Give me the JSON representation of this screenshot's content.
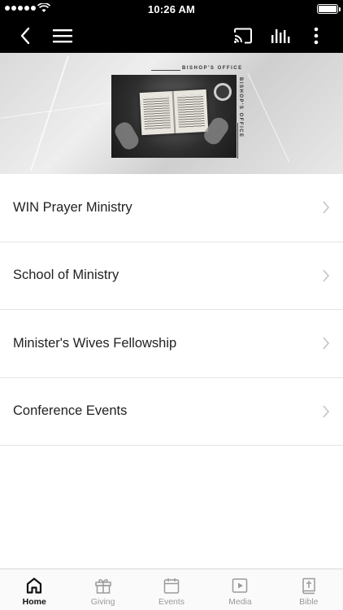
{
  "status_bar": {
    "time": "10:26 AM"
  },
  "nav": {
    "icons": [
      "back-icon",
      "menu-icon",
      "cast-icon",
      "equalizer-icon",
      "more-vertical-icon"
    ]
  },
  "banner": {
    "label": "BISHOP'S OFFICE",
    "colors": {
      "background": "#e2e2e2",
      "photo": "#2e2e2e"
    }
  },
  "list": {
    "items": [
      {
        "label": "WIN Prayer Ministry"
      },
      {
        "label": "School of Ministry"
      },
      {
        "label": "Minister's Wives Fellowship"
      },
      {
        "label": "Conference Events"
      }
    ]
  },
  "tab_bar": {
    "active": "Home",
    "tabs": [
      {
        "label": "Home",
        "icon": "home-icon"
      },
      {
        "label": "Giving",
        "icon": "gift-icon"
      },
      {
        "label": "Events",
        "icon": "calendar-icon"
      },
      {
        "label": "Media",
        "icon": "play-icon"
      },
      {
        "label": "Bible",
        "icon": "bible-icon"
      }
    ]
  },
  "colors": {
    "bars": "#000000",
    "active_tab": "#111111",
    "inactive_tab": "#9a9a9a"
  }
}
